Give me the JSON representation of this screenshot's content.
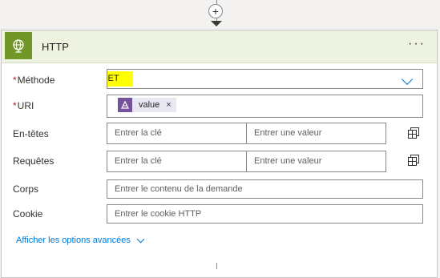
{
  "add_step": {
    "symbol": "+",
    "icon": "plus-icon"
  },
  "action": {
    "title": "HTTP",
    "menu": "···",
    "icon": "globe-icon",
    "accent": "#709727",
    "header_bg": "#eef3e1"
  },
  "fields": {
    "method": {
      "label": "Méthode",
      "required_mark": "*",
      "value": "GET",
      "highlight": "#ffff00"
    },
    "uri": {
      "label": "URI",
      "required_mark": "*",
      "token": {
        "label": "value",
        "remove": "×",
        "icon": "expression-icon",
        "color": "#75529b"
      }
    },
    "headers": {
      "label": "En-têtes",
      "key_placeholder": "Entrer la clé",
      "value_placeholder": "Entrer une valeur"
    },
    "queries": {
      "label": "Requêtes",
      "key_placeholder": "Entrer la clé",
      "value_placeholder": "Entrer une valeur"
    },
    "body": {
      "label": "Corps",
      "placeholder": "Entrer le contenu de la demande"
    },
    "cookie": {
      "label": "Cookie",
      "placeholder": "Entrer le cookie HTTP"
    }
  },
  "advanced_options": {
    "label": "Afficher les options avancées"
  },
  "colors": {
    "link": "#0078d4",
    "required": "#a4262c"
  }
}
